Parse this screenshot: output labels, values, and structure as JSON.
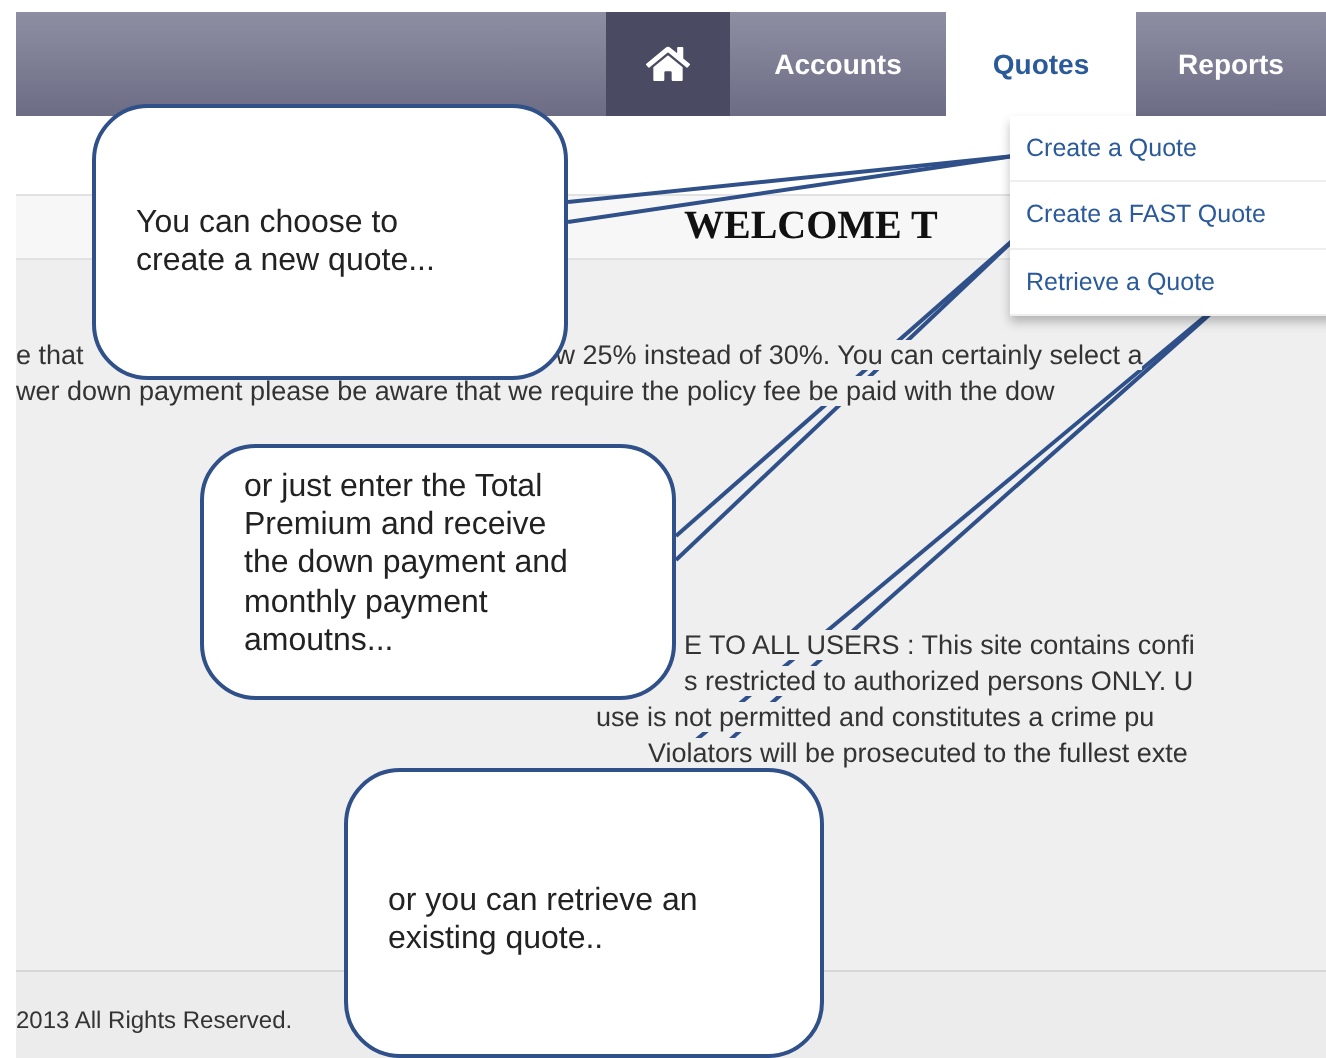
{
  "nav": {
    "items": [
      {
        "kind": "home",
        "selected": false
      },
      {
        "kind": "text",
        "label": "Accounts",
        "selected": false
      },
      {
        "kind": "text",
        "label": "Quotes",
        "selected": true
      },
      {
        "kind": "text",
        "label": "Reports",
        "selected": false
      }
    ]
  },
  "dropdown": {
    "items": [
      "Create a Quote",
      "Create a FAST Quote",
      "Retrieve a Quote"
    ]
  },
  "heading": "WELCOME T",
  "intro": {
    "line_1_left": "e that",
    "line_1_right": "w 25% instead of 30%. You can certainly select a",
    "line_2": "wer down payment please be aware that we require the policy fee be paid with the dow"
  },
  "notice": [
    "E TO ALL USERS : This site contains confi",
    "s restricted to authorized persons ONLY. U",
    "use is not permitted and constitutes a crime pu",
    "Violators will be prosecuted to the fullest exte"
  ],
  "footer": "2013 All Rights Reserved.",
  "callouts": [
    "You can choose to create a new quote...",
    "or just enter the Total Premium and receive the down payment and monthly payment amoutns...",
    "or you can retrieve an existing quote.."
  ]
}
